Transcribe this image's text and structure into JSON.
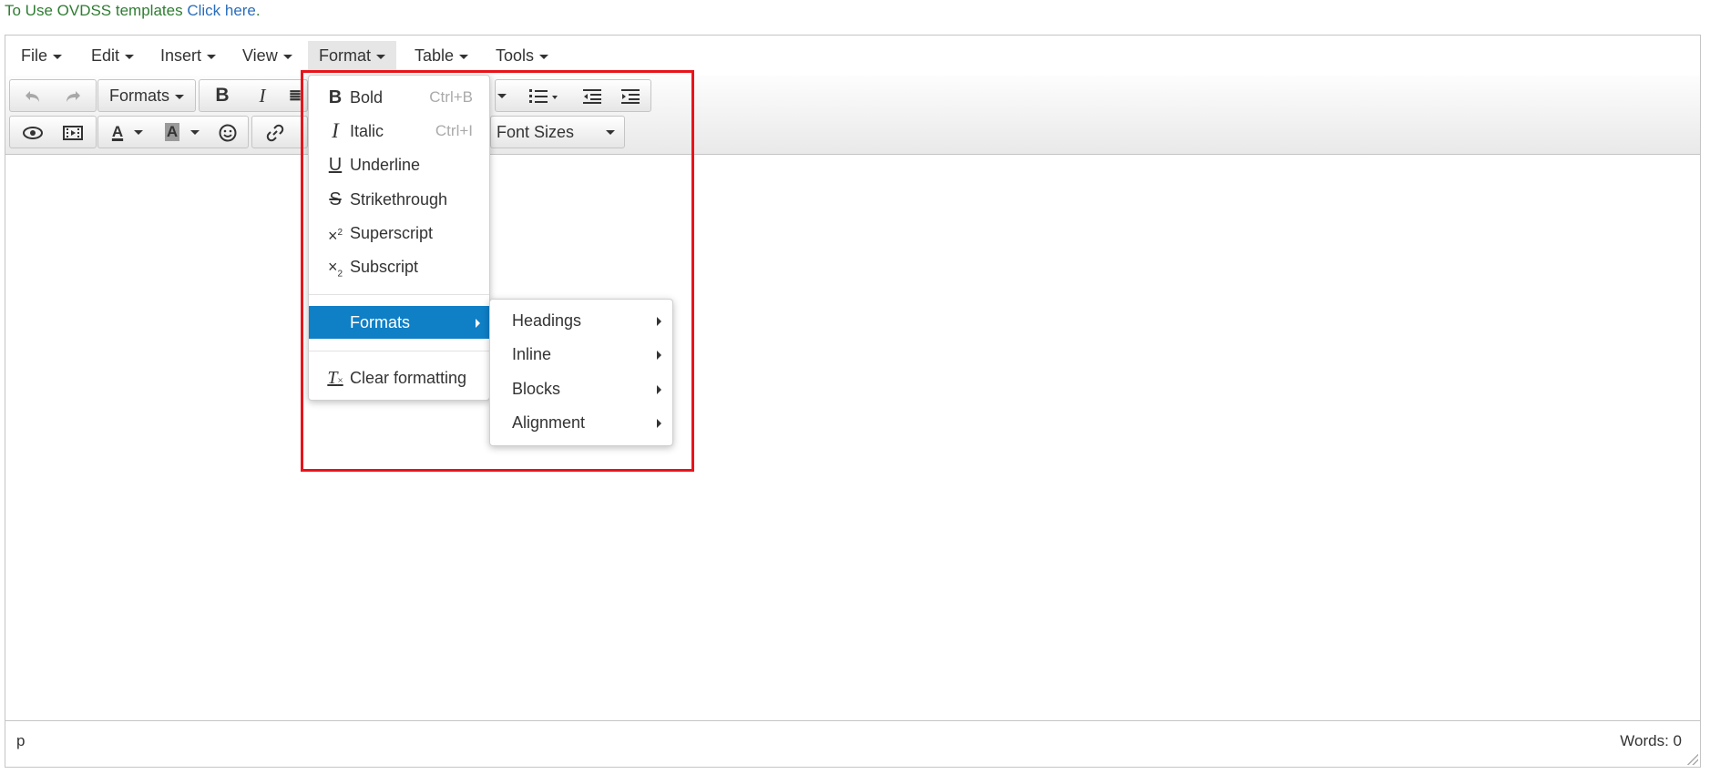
{
  "notice": {
    "text": "To Use OVDSS templates ",
    "link": "Click here",
    "suffix": "."
  },
  "menubar": {
    "items": [
      "File",
      "Edit",
      "Insert",
      "View",
      "Format",
      "Table",
      "Tools"
    ],
    "active": "Format"
  },
  "toolbar": {
    "formats_label": "Formats",
    "font_sizes_label": "Font Sizes"
  },
  "format_menu": {
    "items": [
      {
        "label": "Bold",
        "shortcut": "Ctrl+B",
        "icon": "bold-icon"
      },
      {
        "label": "Italic",
        "shortcut": "Ctrl+I",
        "icon": "italic-icon"
      },
      {
        "label": "Underline",
        "icon": "underline-icon"
      },
      {
        "label": "Strikethrough",
        "icon": "strikethrough-icon"
      },
      {
        "label": "Superscript",
        "icon": "superscript-icon"
      },
      {
        "label": "Subscript",
        "icon": "subscript-icon"
      }
    ],
    "formats_label": "Formats",
    "clear_label": "Clear formatting"
  },
  "formats_submenu": {
    "items": [
      "Headings",
      "Inline",
      "Blocks",
      "Alignment"
    ]
  },
  "statusbar": {
    "path": "p",
    "words": "Words: 0"
  },
  "colors": {
    "accent": "#0f7fc6",
    "highlight_border": "#e8141b",
    "notice_text": "#2f7d32",
    "link": "#2a6ebb"
  }
}
